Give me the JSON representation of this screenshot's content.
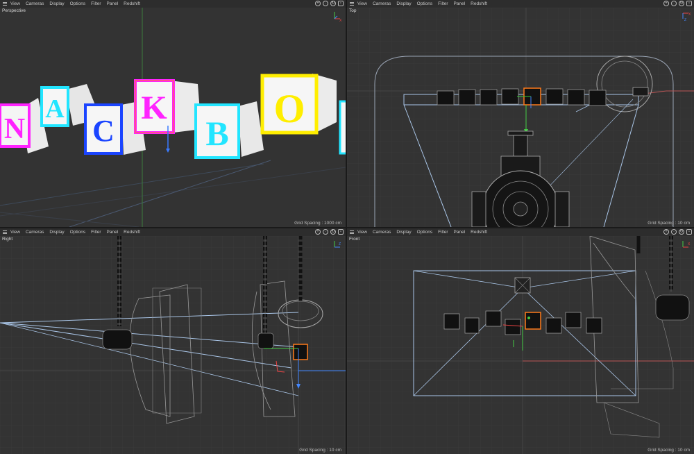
{
  "menu": [
    "View",
    "Cameras",
    "Display",
    "Options",
    "Filter",
    "Panel",
    "Redshift"
  ],
  "viewports": [
    {
      "title": "Perspective",
      "grid_spacing": "Grid Spacing : 1000 cm",
      "axis_x": "X",
      "axis_z": "Z"
    },
    {
      "title": "Top",
      "grid_spacing": "Grid Spacing : 10 cm",
      "axis_x": "X",
      "axis_z": "Z"
    },
    {
      "title": "Right",
      "grid_spacing": "Grid Spacing : 10 cm",
      "axis_x": "",
      "axis_z": "Z"
    },
    {
      "title": "Front",
      "grid_spacing": "Grid Spacing : 10 cm",
      "axis_x": "X",
      "axis_z": ""
    }
  ],
  "blocks": [
    {
      "letter": "N",
      "color": "#ff22ff"
    },
    {
      "letter": "A",
      "color": "#22e5ff"
    },
    {
      "letter": "C",
      "color": "#1a44ff"
    },
    {
      "letter": "K",
      "color": "#ff22ff"
    },
    {
      "letter": "B",
      "color": "#22e5ff"
    },
    {
      "letter": "O",
      "color": "#ffee00"
    }
  ],
  "icons": [
    "move-icon",
    "rotate-icon",
    "reset-icon",
    "maximize-icon"
  ],
  "colors": {
    "viewport_bg": "#333333",
    "menubar_bg": "#2d2d2d",
    "wire": "#aac6e8",
    "selection": "#ff7a1a"
  }
}
